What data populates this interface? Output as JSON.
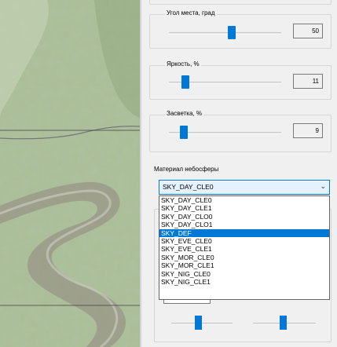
{
  "sliders": [
    {
      "label": "Угол места, град",
      "value": "50",
      "level": 0.5
    },
    {
      "label": "Яркость, %",
      "value": "11",
      "level": 0.11
    },
    {
      "label": "Засветка, %",
      "value": "9",
      "level": 0.09
    }
  ],
  "sky_material": {
    "label": "Материал небосферы",
    "selected": "SKY_DAY_CLE0",
    "options": [
      "SKY_DAY_CLE0",
      "SKY_DAY_CLE1",
      "SKY_DAY_CLO0",
      "SKY_DAY_CLO1",
      "SKY_DEF",
      "SKY_EVE_CLE0",
      "SKY_EVE_CLE1",
      "SKY_MOR_CLE0",
      "SKY_MOR_CLE1",
      "SKY_NIG_CLE0",
      "SKY_NIG_CLE1"
    ],
    "highlighted": "SKY_DEF"
  },
  "colors": {
    "accent": "#0078d7",
    "panel_bg": "#f0f0f0",
    "map_tint": "#a8bd93"
  },
  "icons": {
    "combo_arrow": "chevron-down-icon"
  }
}
